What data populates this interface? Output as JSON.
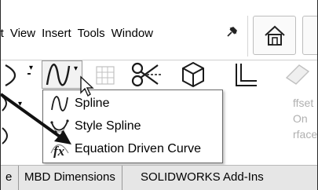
{
  "menu": {
    "items": [
      "lit",
      "View",
      "Insert",
      "Tools",
      "Window"
    ],
    "pin_icon": "pin-icon"
  },
  "dropdown": {
    "items": [
      {
        "label": "Spline",
        "icon": "spline-icon"
      },
      {
        "label": "Style Spline",
        "icon": "style-spline-icon"
      },
      {
        "label": "Equation Driven Curve",
        "icon": "equation-curve-icon"
      }
    ]
  },
  "ribbon": {
    "ghost_labels": [
      "ffset",
      "On",
      "rface"
    ]
  },
  "tabs": {
    "items": [
      "e",
      "MBD Dimensions",
      "SOLIDWORKS Add-Ins"
    ]
  },
  "colors": {
    "tab_bg": "#e6e6e6",
    "menu_border": "#6a6a6a",
    "icon_stroke": "#1a1a1a",
    "disabled": "#b0b0b0"
  }
}
